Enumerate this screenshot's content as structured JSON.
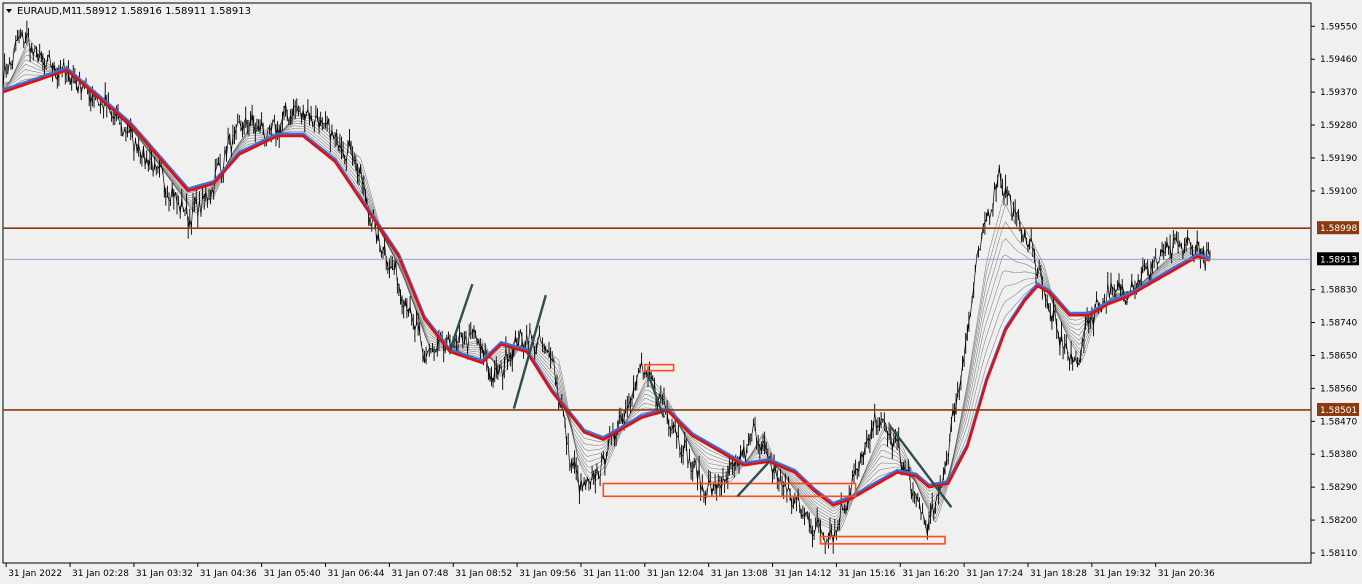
{
  "header": {
    "symbol": "EURAUD,M1",
    "ohlc": "1.58912 1.58916 1.58911 1.58913"
  },
  "colors": {
    "background": "#f0f0f0",
    "price": "#000000",
    "ema_main": "#e01010",
    "ema_secondary": "#3a6fe0",
    "level": "#8b3a0f",
    "current_line": "#6f8fb8",
    "current_tag": "#000000",
    "boxes": "#ff4a1a",
    "trendlines": "#2f4f4f"
  },
  "chart_data": {
    "type": "line",
    "title": "",
    "ylim": [
      1.5811,
      1.596
    ],
    "y_ticks": [
      "1.59550",
      "1.59460",
      "1.59370",
      "1.59280",
      "1.59190",
      "1.59100",
      "1.58830",
      "1.58740",
      "1.58650",
      "1.58560",
      "1.58470",
      "1.58380",
      "1.58290",
      "1.58200",
      "1.58110"
    ],
    "x_ticks": [
      "31 Jan 2022",
      "31 Jan 02:28",
      "31 Jan 03:32",
      "31 Jan 04:36",
      "31 Jan 05:40",
      "31 Jan 06:44",
      "31 Jan 07:48",
      "31 Jan 08:52",
      "31 Jan 09:56",
      "31 Jan 11:00",
      "31 Jan 12:04",
      "31 Jan 13:08",
      "31 Jan 14:12",
      "31 Jan 15:16",
      "31 Jan 16:20",
      "31 Jan 17:24",
      "31 Jan 18:28",
      "31 Jan 19:32",
      "31 Jan 20:36"
    ],
    "levels": [
      {
        "label": "1.58998",
        "value": 1.58998
      },
      {
        "label": "1.58501",
        "value": 1.58501
      }
    ],
    "current_price": {
      "label": "1.58913",
      "value": 1.58913
    },
    "price_anchors": [
      [
        0,
        1.594
      ],
      [
        3,
        1.5953
      ],
      [
        6,
        1.5945
      ],
      [
        10,
        1.5942
      ],
      [
        15,
        1.5935
      ],
      [
        20,
        1.5925
      ],
      [
        25,
        1.5913
      ],
      [
        29,
        1.5903
      ],
      [
        32,
        1.5908
      ],
      [
        35,
        1.5921
      ],
      [
        38,
        1.5929
      ],
      [
        42,
        1.5925
      ],
      [
        45,
        1.5932
      ],
      [
        48,
        1.5931
      ],
      [
        51,
        1.5926
      ],
      [
        55,
        1.592
      ],
      [
        58,
        1.59
      ],
      [
        62,
        1.5885
      ],
      [
        66,
        1.5865
      ],
      [
        70,
        1.5868
      ],
      [
        74,
        1.587
      ],
      [
        77,
        1.5858
      ],
      [
        80,
        1.5868
      ],
      [
        82,
        1.587
      ],
      [
        86,
        1.5865
      ],
      [
        89,
        1.5835
      ],
      [
        91,
        1.5828
      ],
      [
        93,
        1.5832
      ],
      [
        96,
        1.5845
      ],
      [
        100,
        1.5861
      ],
      [
        102,
        1.5856
      ],
      [
        104,
        1.585
      ],
      [
        107,
        1.5838
      ],
      [
        110,
        1.5828
      ],
      [
        113,
        1.583
      ],
      [
        116,
        1.5838
      ],
      [
        118,
        1.5845
      ],
      [
        120,
        1.5835
      ],
      [
        124,
        1.5825
      ],
      [
        127,
        1.5818
      ],
      [
        130,
        1.5816
      ],
      [
        133,
        1.583
      ],
      [
        137,
        1.5848
      ],
      [
        140,
        1.584
      ],
      [
        143,
        1.5825
      ],
      [
        145,
        1.5818
      ],
      [
        147,
        1.583
      ],
      [
        150,
        1.586
      ],
      [
        153,
        1.5895
      ],
      [
        156,
        1.5915
      ],
      [
        158,
        1.5905
      ],
      [
        160,
        1.5898
      ],
      [
        162,
        1.589
      ],
      [
        164,
        1.5876
      ],
      [
        166,
        1.5868
      ],
      [
        168,
        1.5862
      ],
      [
        170,
        1.5875
      ],
      [
        173,
        1.5882
      ],
      [
        176,
        1.5883
      ],
      [
        179,
        1.5888
      ],
      [
        182,
        1.5893
      ],
      [
        185,
        1.5895
      ],
      [
        187,
        1.5894
      ],
      [
        189,
        1.5891
      ]
    ],
    "ema_anchors": [
      [
        0,
        1.5937
      ],
      [
        10,
        1.5943
      ],
      [
        20,
        1.5928
      ],
      [
        29,
        1.591
      ],
      [
        33,
        1.5912
      ],
      [
        37,
        1.592
      ],
      [
        43,
        1.5925
      ],
      [
        47,
        1.5925
      ],
      [
        52,
        1.5918
      ],
      [
        57,
        1.5905
      ],
      [
        62,
        1.5892
      ],
      [
        66,
        1.5875
      ],
      [
        70,
        1.5866
      ],
      [
        75,
        1.5863
      ],
      [
        78,
        1.5868
      ],
      [
        82,
        1.5866
      ],
      [
        86,
        1.5855
      ],
      [
        91,
        1.5844
      ],
      [
        94,
        1.5842
      ],
      [
        100,
        1.5848
      ],
      [
        104,
        1.585
      ],
      [
        108,
        1.5843
      ],
      [
        113,
        1.5838
      ],
      [
        116,
        1.5835
      ],
      [
        120,
        1.5836
      ],
      [
        124,
        1.5833
      ],
      [
        127,
        1.5828
      ],
      [
        130,
        1.5824
      ],
      [
        133,
        1.5826
      ],
      [
        137,
        1.583
      ],
      [
        140,
        1.5833
      ],
      [
        143,
        1.5832
      ],
      [
        145,
        1.5829
      ],
      [
        148,
        1.583
      ],
      [
        151,
        1.584
      ],
      [
        154,
        1.5858
      ],
      [
        157,
        1.5872
      ],
      [
        160,
        1.588
      ],
      [
        162,
        1.5884
      ],
      [
        164,
        1.5882
      ],
      [
        167,
        1.5876
      ],
      [
        170,
        1.5876
      ],
      [
        173,
        1.5879
      ],
      [
        176,
        1.5881
      ],
      [
        179,
        1.5884
      ],
      [
        182,
        1.5887
      ],
      [
        185,
        1.589
      ],
      [
        187,
        1.5892
      ],
      [
        189,
        1.5891
      ]
    ],
    "boxes": [
      {
        "x0": 100.5,
        "x1": 105,
        "y0": 1.58625,
        "y1": 1.58618
      },
      {
        "x0": 94,
        "x1": 133.5,
        "y0": 1.583,
        "y1": 1.58265
      },
      {
        "x0": 128,
        "x1": 147.5,
        "y0": 1.58155,
        "y1": 1.58135
      }
    ],
    "trendlines": [
      {
        "x0": 70,
        "y0": 1.58665,
        "x1": 73.5,
        "y1": 1.58845
      },
      {
        "x0": 80,
        "y0": 1.58505,
        "x1": 85,
        "y1": 1.58815
      },
      {
        "x0": 101,
        "y0": 1.586,
        "x1": 103.5,
        "y1": 1.5848
      },
      {
        "x0": 115,
        "y0": 1.58265,
        "x1": 120,
        "y1": 1.5836
      },
      {
        "x0": 139,
        "y0": 1.58455,
        "x1": 148.5,
        "y1": 1.58235
      }
    ]
  }
}
